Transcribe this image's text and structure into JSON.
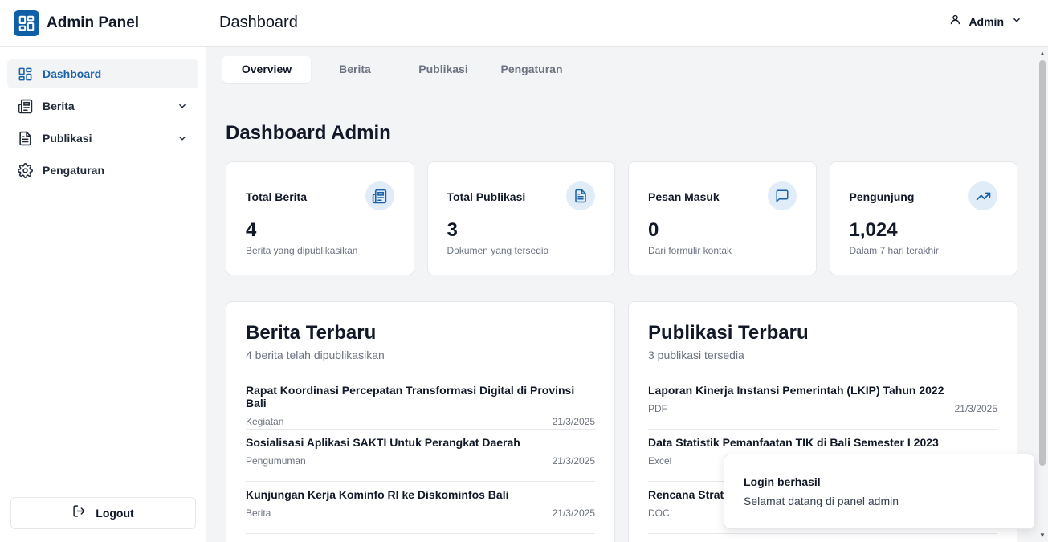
{
  "app": {
    "title": "Admin Panel",
    "accent": "#1b62a8"
  },
  "sidebar": {
    "items": [
      {
        "label": "Dashboard",
        "icon": "layout-dashboard-icon",
        "active": true
      },
      {
        "label": "Berita",
        "icon": "newspaper-icon",
        "expandable": true
      },
      {
        "label": "Publikasi",
        "icon": "file-text-icon",
        "expandable": true
      },
      {
        "label": "Pengaturan",
        "icon": "settings-gear-icon"
      }
    ],
    "logout_label": "Logout"
  },
  "header": {
    "title": "Dashboard",
    "user": "Admin"
  },
  "tabs": [
    {
      "label": "Overview",
      "active": true
    },
    {
      "label": "Berita"
    },
    {
      "label": "Publikasi"
    },
    {
      "label": "Pengaturan"
    }
  ],
  "main": {
    "heading": "Dashboard Admin",
    "stats": [
      {
        "title": "Total Berita",
        "value": "4",
        "desc": "Berita yang dipublikasikan",
        "icon": "newspaper-icon"
      },
      {
        "title": "Total Publikasi",
        "value": "3",
        "desc": "Dokumen yang tersedia",
        "icon": "file-text-icon"
      },
      {
        "title": "Pesan Masuk",
        "value": "0",
        "desc": "Dari formulir kontak",
        "icon": "message-square-icon"
      },
      {
        "title": "Pengunjung",
        "value": "1,024",
        "desc": "Dalam 7 hari terakhir",
        "icon": "trending-up-icon"
      }
    ],
    "berita": {
      "title": "Berita Terbaru",
      "subtitle": "4 berita telah dipublikasikan",
      "items": [
        {
          "title": "Rapat Koordinasi Percepatan Transformasi Digital di Provinsi Bali",
          "category": "Kegiatan",
          "date": "21/3/2025"
        },
        {
          "title": "Sosialisasi Aplikasi SAKTI Untuk Perangkat Daerah",
          "category": "Pengumuman",
          "date": "21/3/2025"
        },
        {
          "title": "Kunjungan Kerja Kominfo RI ke Diskominfos Bali",
          "category": "Berita",
          "date": "21/3/2025"
        }
      ]
    },
    "publikasi": {
      "title": "Publikasi Terbaru",
      "subtitle": "3 publikasi tersedia",
      "items": [
        {
          "title": "Laporan Kinerja Instansi Pemerintah (LKIP) Tahun 2022",
          "category": "PDF",
          "date": "21/3/2025"
        },
        {
          "title": "Data Statistik Pemanfaatan TIK di Bali Semester I 2023",
          "category": "Excel",
          "date": ""
        },
        {
          "title": "Rencana Strate",
          "category": "DOC",
          "date": ""
        }
      ]
    }
  },
  "toast": {
    "title": "Login berhasil",
    "message": "Selamat datang di panel admin"
  }
}
